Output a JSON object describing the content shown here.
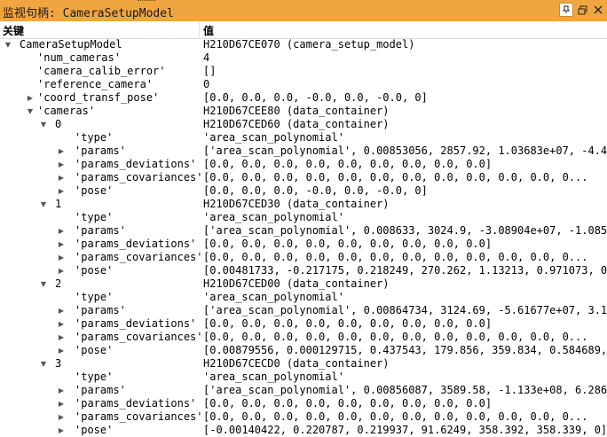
{
  "window": {
    "title": "监视句柄: CameraSetupModel"
  },
  "header": {
    "key_label": "关键",
    "value_label": "值"
  },
  "rows": [
    {
      "level": 0,
      "arrow": "down",
      "key": "CameraSetupModel",
      "value": "H210D67CE070 (camera_setup_model)"
    },
    {
      "level": 1,
      "arrow": "none",
      "key": "'num_cameras'",
      "value": "4"
    },
    {
      "level": 1,
      "arrow": "none",
      "key": "'camera_calib_error'",
      "value": "[]"
    },
    {
      "level": 1,
      "arrow": "none",
      "key": "'reference_camera'",
      "value": "0"
    },
    {
      "level": 1,
      "arrow": "right",
      "key": "'coord_transf_pose'",
      "value": "[0.0, 0.0, 0.0, -0.0, 0.0, -0.0, 0]"
    },
    {
      "level": 1,
      "arrow": "down",
      "key": "'cameras'",
      "value": "H210D67CEE80 (data_container)"
    },
    {
      "level": 2,
      "arrow": "down",
      "key": "0",
      "value": "H210D67CED60 (data_container)"
    },
    {
      "level": 3,
      "arrow": "none",
      "key": "'type'",
      "value": "'area_scan_polynomial'"
    },
    {
      "level": 3,
      "arrow": "right",
      "key": "'params'",
      "value": "['area_scan_polynomial', 0.00853056, 2857.92, 1.03683e+07, -4.4..."
    },
    {
      "level": 3,
      "arrow": "right",
      "key": "'params_deviations'",
      "value": "[0.0, 0.0, 0.0, 0.0, 0.0, 0.0, 0.0, 0.0, 0.0]"
    },
    {
      "level": 3,
      "arrow": "right",
      "key": "'params_covariances'",
      "value": "[0.0, 0.0, 0.0, 0.0, 0.0, 0.0, 0.0, 0.0, 0.0, 0.0, 0.0, 0..."
    },
    {
      "level": 3,
      "arrow": "right",
      "key": "'pose'",
      "value": "[0.0, 0.0, 0.0, -0.0, 0.0, -0.0, 0]"
    },
    {
      "level": 2,
      "arrow": "down",
      "key": "1",
      "value": "H210D67CED30 (data_container)"
    },
    {
      "level": 3,
      "arrow": "none",
      "key": "'type'",
      "value": "'area_scan_polynomial'"
    },
    {
      "level": 3,
      "arrow": "right",
      "key": "'params'",
      "value": "['area_scan_polynomial', 0.008633, 3024.9, -3.08904e+07, -1.085..."
    },
    {
      "level": 3,
      "arrow": "right",
      "key": "'params_deviations'",
      "value": "[0.0, 0.0, 0.0, 0.0, 0.0, 0.0, 0.0, 0.0, 0.0]"
    },
    {
      "level": 3,
      "arrow": "right",
      "key": "'params_covariances'",
      "value": "[0.0, 0.0, 0.0, 0.0, 0.0, 0.0, 0.0, 0.0, 0.0, 0.0, 0.0, 0..."
    },
    {
      "level": 3,
      "arrow": "right",
      "key": "'pose'",
      "value": "[0.00481733, -0.217175, 0.218249, 270.262, 1.13213, 0.971073, 0]"
    },
    {
      "level": 2,
      "arrow": "down",
      "key": "2",
      "value": "H210D67CED00 (data_container)"
    },
    {
      "level": 3,
      "arrow": "none",
      "key": "'type'",
      "value": "'area_scan_polynomial'"
    },
    {
      "level": 3,
      "arrow": "right",
      "key": "'params'",
      "value": "['area_scan_polynomial', 0.00864734, 3124.69, -5.61677e+07, 3.1..."
    },
    {
      "level": 3,
      "arrow": "right",
      "key": "'params_deviations'",
      "value": "[0.0, 0.0, 0.0, 0.0, 0.0, 0.0, 0.0, 0.0, 0.0]"
    },
    {
      "level": 3,
      "arrow": "right",
      "key": "'params_covariances'",
      "value": "[0.0, 0.0, 0.0, 0.0, 0.0, 0.0, 0.0, 0.0, 0.0, 0.0, 0.0, 0..."
    },
    {
      "level": 3,
      "arrow": "right",
      "key": "'pose'",
      "value": "[0.00879556, 0.000129715, 0.437543, 179.856, 359.834, 0.584689,..."
    },
    {
      "level": 2,
      "arrow": "down",
      "key": "3",
      "value": "H210D67CECD0 (data_container)"
    },
    {
      "level": 3,
      "arrow": "none",
      "key": "'type'",
      "value": "'area_scan_polynomial'"
    },
    {
      "level": 3,
      "arrow": "right",
      "key": "'params'",
      "value": "['area_scan_polynomial', 0.00856087, 3589.58, -1.133e+08, 6.286..."
    },
    {
      "level": 3,
      "arrow": "right",
      "key": "'params_deviations'",
      "value": "[0.0, 0.0, 0.0, 0.0, 0.0, 0.0, 0.0, 0.0, 0.0]"
    },
    {
      "level": 3,
      "arrow": "right",
      "key": "'params_covariances'",
      "value": "[0.0, 0.0, 0.0, 0.0, 0.0, 0.0, 0.0, 0.0, 0.0, 0.0, 0.0, 0..."
    },
    {
      "level": 3,
      "arrow": "right",
      "key": "'pose'",
      "value": "[-0.00140422, 0.220787, 0.219937, 91.6249, 358.392, 358.339, 0]"
    }
  ],
  "colors": {
    "titlebar": "#f0a640",
    "background": "#ffffff"
  },
  "icons": {
    "pin": "pin-icon",
    "float": "float-window-icon",
    "close": "close-icon"
  }
}
